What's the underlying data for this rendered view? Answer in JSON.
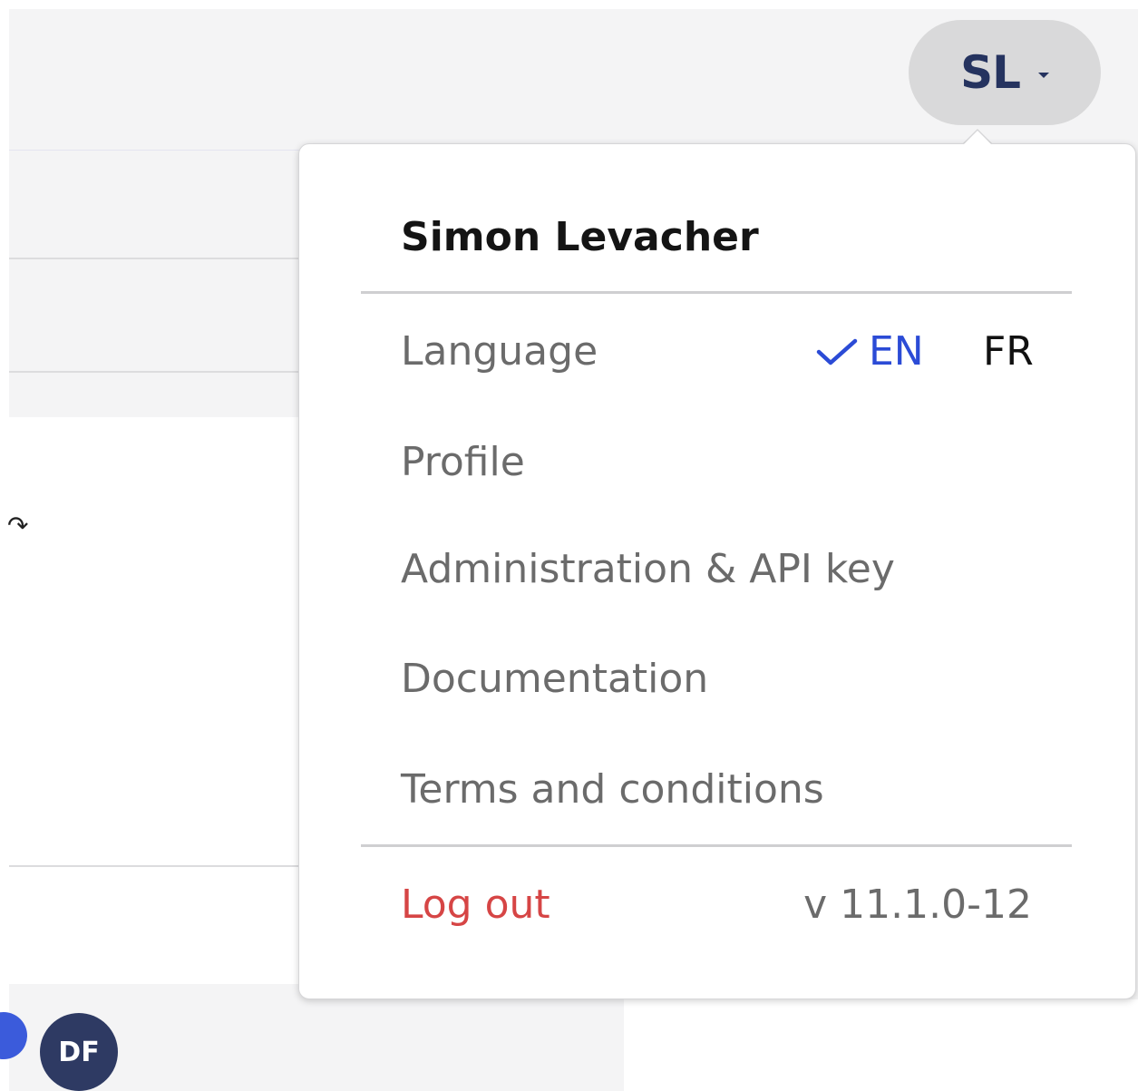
{
  "header": {
    "user_initials": "SL"
  },
  "user_menu": {
    "user_name": "Simon Levacher",
    "language_label": "Language",
    "languages": [
      {
        "code": "EN",
        "selected": true
      },
      {
        "code": "FR",
        "selected": false
      }
    ],
    "items": [
      {
        "label": "Profile"
      },
      {
        "label": "Administration & API key"
      },
      {
        "label": "Documentation"
      },
      {
        "label": "Terms and conditions"
      }
    ],
    "logout_label": "Log out",
    "version": "v 11.1.0-12"
  },
  "background": {
    "avatars": [
      {
        "initials": "DF"
      }
    ]
  },
  "colors": {
    "accent": "#2b4bd6",
    "danger": "#d64545",
    "trigger_bg": "#d9d9da",
    "initials_text": "#25335f"
  }
}
